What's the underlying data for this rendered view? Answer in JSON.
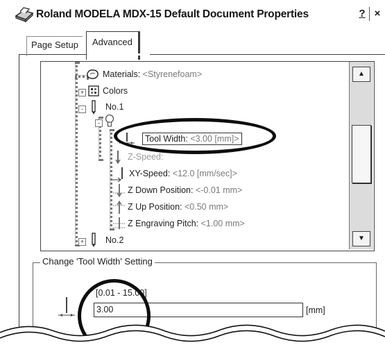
{
  "window": {
    "title": "Roland MODELA MDX-15 Default Document Properties",
    "help_button": "?",
    "close_button": "×"
  },
  "tabs": [
    {
      "label": "Page Setup",
      "active": false
    },
    {
      "label": "Advanced",
      "active": true
    }
  ],
  "tree": {
    "items": [
      {
        "label": "Materials:",
        "value": "<Styrenefoam>",
        "icon": "materials-icon"
      },
      {
        "label": "Colors",
        "value": "",
        "icon": "colors-icon",
        "expander": "+"
      },
      {
        "label": "No.1",
        "value": "",
        "icon": "pen-icon",
        "expander": "-"
      },
      {
        "label": "",
        "value": "",
        "icon": "bulb-icon",
        "expander": "-"
      },
      {
        "label": "Tool Width:",
        "value": "<3.00 [mm]>",
        "icon": "tool-width-icon",
        "selected": true
      },
      {
        "label": "Z-Speed:",
        "value": "",
        "icon": "z-speed-icon"
      },
      {
        "label": "XY-Speed:",
        "value": "<12.0 [mm/sec]>",
        "icon": "xy-speed-icon"
      },
      {
        "label": "Z Down Position:",
        "value": "<-0.01 mm>",
        "icon": "z-down-icon"
      },
      {
        "label": "Z Up Position:",
        "value": "<0.50 mm>",
        "icon": "z-up-icon"
      },
      {
        "label": "Z Engraving Pitch:",
        "value": "<1.00 mm>",
        "icon": "z-pitch-icon"
      },
      {
        "label": "No.2",
        "value": "",
        "icon": "pen-icon",
        "expander": "+"
      }
    ],
    "scroll_up": "▲",
    "scroll_down": "▼"
  },
  "setting": {
    "group_label": "Change 'Tool Width' Setting",
    "range": "[0.01 - 15.00]",
    "value": "3.00",
    "unit": "[mm]"
  }
}
